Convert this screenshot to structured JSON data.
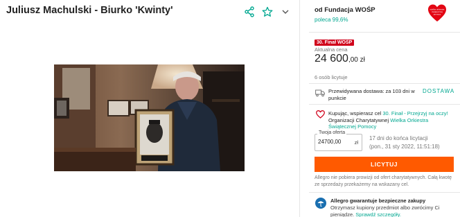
{
  "listing": {
    "title": "Juliusz Machulski - Biurko 'Kwinty'"
  },
  "icons": {
    "share": "share-icon",
    "watch": "star-icon",
    "more": "chevron-down-icon"
  },
  "seller": {
    "name": "od Fundacja WOŚP",
    "recommend": "poleca 99,6%",
    "logo_lines": [
      "wielka orkiestra",
      "świątecznej",
      "pomocy"
    ]
  },
  "pricing": {
    "badge": "30. Finał WOŚP",
    "label": "Aktualna cena",
    "amount": "24 600",
    "cents": ",00 zł",
    "bidders": "6 osób licytuje"
  },
  "delivery": {
    "text": "Przewidywana dostawa: za 103 dni w punkcie",
    "link": "DOSTAWA"
  },
  "charity": {
    "prefix": "Kupując, wspierasz cel ",
    "goal": "30. Finał - Przejrzyj na oczy!",
    "org_prefix": " Organizacji Charytatywnej ",
    "org": "Wielka Orkiestra Świątecznej Pomocy"
  },
  "offer": {
    "legend": "Twoja oferta",
    "value": "24700,00",
    "currency": "zł",
    "remaining": "17 dni do końca licytacji",
    "end_date": "(pon., 31 sty 2022, 11:51:18)"
  },
  "bid_button": "LICYTUJ",
  "note": "Allegro nie pobiera prowizji od ofert charytatywnych. Całą kwotę ze sprzedaży przekażemy na wskazany cel.",
  "guarantee": {
    "title": "Allegro gwarantuje bezpieczne zakupy",
    "text": "Otrzymasz kupiony przedmiot albo zwrócimy Ci pieniądze. ",
    "link": "Sprawdź szczegóły."
  },
  "colors": {
    "accent": "#00a790",
    "button": "#ff5a00",
    "badge": "#d0021b",
    "logo": "#e30613"
  }
}
